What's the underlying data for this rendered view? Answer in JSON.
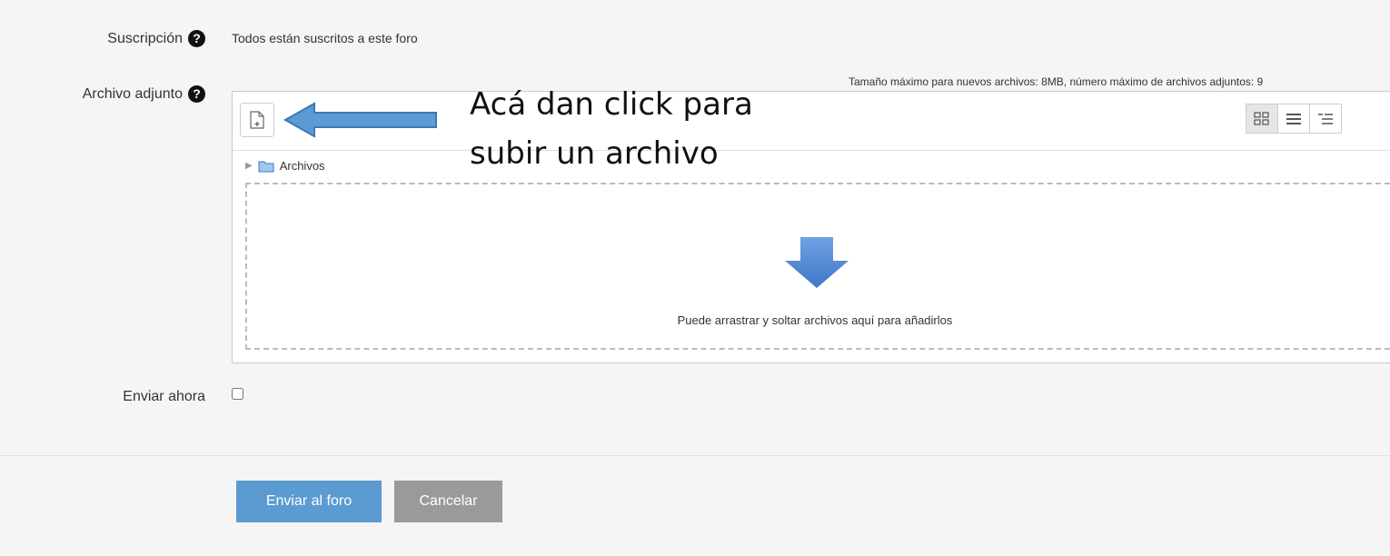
{
  "form": {
    "subscription": {
      "label": "Suscripción",
      "value": "Todos están suscritos a este foro"
    },
    "attachment": {
      "label": "Archivo adjunto",
      "max_size_note": "Tamaño máximo para nuevos archivos: 8MB, número máximo de archivos adjuntos: 9",
      "path_label": "Archivos",
      "drop_text": "Puede arrastrar y soltar archivos aquí para añadirlos"
    },
    "send_now": {
      "label": "Enviar ahora",
      "checked": false
    },
    "buttons": {
      "submit": "Enviar al foro",
      "cancel": "Cancelar"
    }
  },
  "annotation": {
    "line1": "Acá dan click para",
    "line2": "subir un archivo",
    "arrow_color": "#5b9bd5"
  },
  "colors": {
    "primary": "#5b9bd1",
    "cancel": "#9a9a9a",
    "drop_arrow": "#5b8fd6"
  },
  "icons": {
    "help": "question-circle-icon",
    "add_file": "add-file-icon",
    "view_icons": "grid-view-icon",
    "view_list": "list-view-icon",
    "view_tree": "tree-view-icon",
    "folder": "folder-icon",
    "expand": "expand-triangle-icon",
    "drop": "down-arrow-icon"
  }
}
